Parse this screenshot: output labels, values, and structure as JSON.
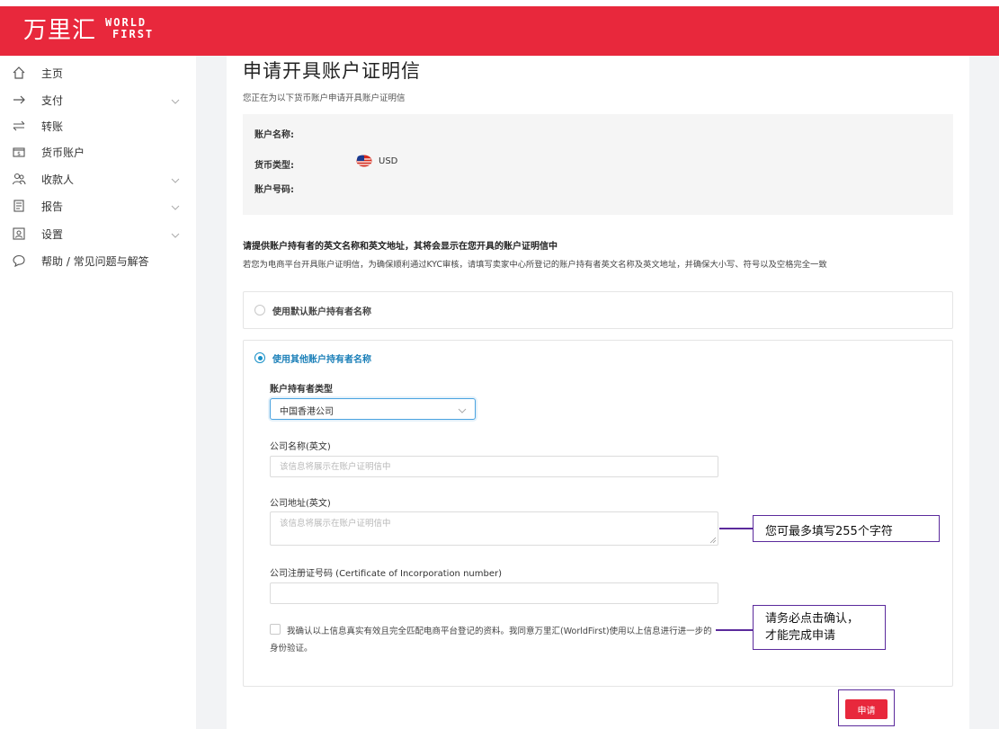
{
  "brand": {
    "name_cn": "万里汇",
    "name_en_line1": "WORLD",
    "name_en_line2": "FIRST",
    "color": "#e8283c"
  },
  "sidebar": {
    "items": [
      {
        "label": "主页",
        "icon": "home-icon",
        "expandable": false
      },
      {
        "label": "支付",
        "icon": "arrow-right-icon",
        "expandable": true
      },
      {
        "label": "转账",
        "icon": "transfer-icon",
        "expandable": false
      },
      {
        "label": "货币账户",
        "icon": "wallet-icon",
        "expandable": false
      },
      {
        "label": "收款人",
        "icon": "people-icon",
        "expandable": true
      },
      {
        "label": "报告",
        "icon": "report-icon",
        "expandable": true
      },
      {
        "label": "设置",
        "icon": "settings-icon",
        "expandable": true
      },
      {
        "label": "帮助 / 常见问题与解答",
        "icon": "chat-help-icon",
        "expandable": false
      }
    ]
  },
  "page": {
    "title": "申请开具账户证明信",
    "subtitle": "您正在为以下货币账户申请开具账户证明信"
  },
  "account_info": {
    "name_label": "账户名称:",
    "currency_label": "货币类型:",
    "currency_code": "USD",
    "currency_flag": "us-flag-icon",
    "number_label": "账户号码:"
  },
  "instructions": {
    "title": "请提供账户持有者的英文名称和英文地址，其将会显示在您开具的账户证明信中",
    "body": "若您为电商平台开具账户证明信，为确保顺利通过KYC审核，请填写卖家中心所登记的账户持有者英文名称及英文地址，并确保大小写、符号以及空格完全一致"
  },
  "options": {
    "default_label": "使用默认账户持有者名称",
    "other_label": "使用其他账户持有者名称",
    "selected": "other"
  },
  "form": {
    "holder_type_label": "账户持有者类型",
    "holder_type_value": "中国香港公司",
    "company_name_label": "公司名称(英文)",
    "company_name_placeholder": "该信息将展示在账户证明信中",
    "company_address_label": "公司地址(英文)",
    "company_address_placeholder": "该信息将展示在账户证明信中",
    "reg_number_label": "公司注册证号码 (Certificate of Incorporation number)",
    "reg_number_value": "",
    "confirm_text": "我确认以上信息真实有效且完全匹配电商平台登记的资料。我同意万里汇(WorldFirst)使用以上信息进行进一步的身份验证。",
    "confirm_checked": false
  },
  "callouts": {
    "address_note": "您可最多填写255个字符",
    "confirm_note_line1": "请务必点击确认，",
    "confirm_note_line2": "才能完成申请"
  },
  "submit_label": "申请",
  "colors": {
    "accent": "#e8283c",
    "radio": "#1890c8",
    "callout": "#5b2a9c"
  }
}
